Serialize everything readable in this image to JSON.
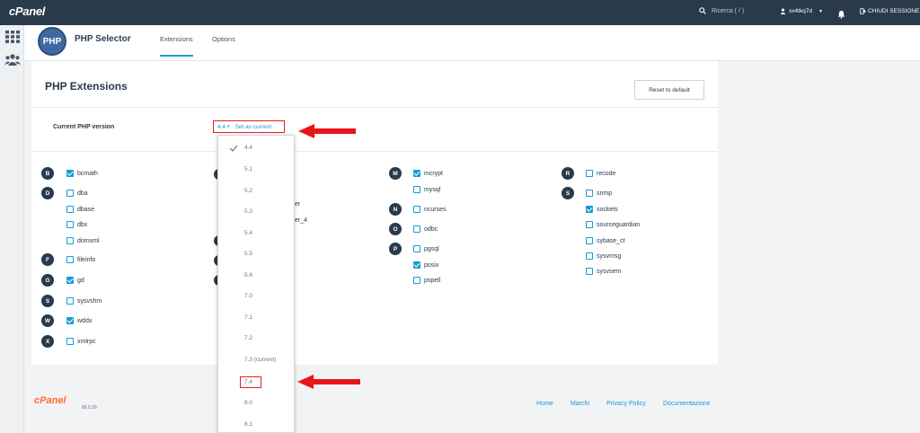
{
  "topbar": {
    "logo": "cPanel",
    "search_placeholder": "Ricerca ( / )",
    "username": "xx4tkq7d",
    "logout": "CHIUDI SESSIONE"
  },
  "header": {
    "badge": "PHP",
    "app_title": "PHP Selector",
    "tabs": [
      {
        "label": "Extensions",
        "active": true
      },
      {
        "label": "Options",
        "active": false
      }
    ]
  },
  "panel": {
    "title": "PHP Extensions",
    "reset_button": "Reset to default",
    "current_label": "Current PHP version",
    "current_value": "4.4",
    "set_current": "Set as current"
  },
  "extensions": {
    "col1": [
      {
        "letter": "B",
        "items": [
          {
            "name": "bcmath",
            "checked": true
          }
        ]
      },
      {
        "letter": "D",
        "items": [
          {
            "name": "dba",
            "checked": false
          },
          {
            "name": "dbase",
            "checked": false
          },
          {
            "name": "dbx",
            "checked": false
          },
          {
            "name": "domxml",
            "checked": false
          }
        ]
      },
      {
        "letter": "F",
        "items": [
          {
            "name": "fileinfo",
            "checked": false
          }
        ]
      },
      {
        "letter": "G",
        "items": [
          {
            "name": "gd",
            "checked": true
          }
        ]
      },
      {
        "letter": "S",
        "items": [
          {
            "name": "sysvshm",
            "checked": false
          }
        ]
      },
      {
        "letter": "W",
        "items": [
          {
            "name": "wddx",
            "checked": true
          }
        ]
      },
      {
        "letter": "X",
        "items": [
          {
            "name": "xmlrpc",
            "checked": false
          }
        ]
      }
    ],
    "col2_partial": [
      "er",
      "er_4"
    ],
    "col3": [
      {
        "letter": "M",
        "items": [
          {
            "name": "mcrypt",
            "checked": true
          },
          {
            "name": "mysql",
            "checked": false
          }
        ]
      },
      {
        "letter": "N",
        "items": [
          {
            "name": "ncurses",
            "checked": false
          }
        ]
      },
      {
        "letter": "O",
        "items": [
          {
            "name": "odbc",
            "checked": false
          }
        ]
      },
      {
        "letter": "P",
        "items": [
          {
            "name": "pgsql",
            "checked": false
          },
          {
            "name": "posix",
            "checked": true
          },
          {
            "name": "pspell",
            "checked": false
          }
        ]
      }
    ],
    "col4": [
      {
        "letter": "R",
        "items": [
          {
            "name": "recode",
            "checked": false
          }
        ]
      },
      {
        "letter": "S",
        "items": [
          {
            "name": "snmp",
            "checked": false
          },
          {
            "name": "sockets",
            "checked": true
          },
          {
            "name": "sourceguardian",
            "checked": false
          },
          {
            "name": "sybase_ct",
            "checked": false
          },
          {
            "name": "sysvmsg",
            "checked": false
          },
          {
            "name": "sysvsem",
            "checked": false
          }
        ]
      }
    ]
  },
  "dropdown": {
    "options": [
      "4.4",
      "5.1",
      "5.2",
      "5.3",
      "5.4",
      "5.5",
      "5.6",
      "7.0",
      "7.1",
      "7.2",
      "7.3 (current)",
      "7.4",
      "8.0",
      "8.1"
    ],
    "selected": "4.4",
    "highlighted": "7.4"
  },
  "footer": {
    "logo": "cPanel",
    "version": "86.0.29",
    "links": [
      "Home",
      "Marchi",
      "Privacy Policy",
      "Documentazione"
    ]
  },
  "colors": {
    "topbar": "#293a4a",
    "accent": "#179bd7",
    "highlight": "#e02020",
    "footer_logo": "#ff6c2c"
  }
}
